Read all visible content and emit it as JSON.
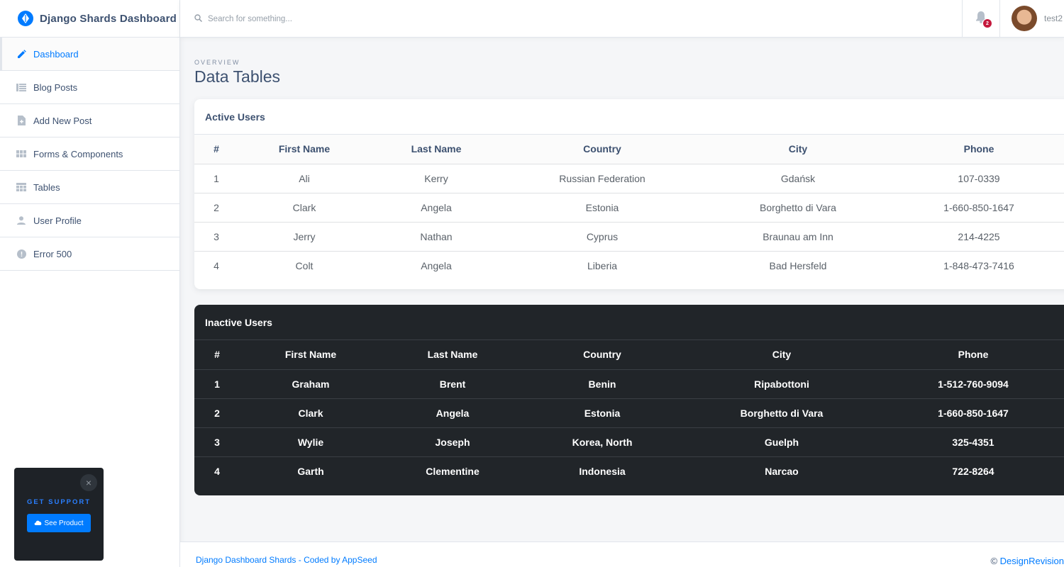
{
  "brand": {
    "title": "Django Shards Dashboard"
  },
  "sidebar": {
    "items": [
      {
        "label": "Dashboard",
        "icon": "edit-icon",
        "active": true
      },
      {
        "label": "Blog Posts",
        "icon": "blog-icon"
      },
      {
        "label": "Add New Post",
        "icon": "note-add-icon"
      },
      {
        "label": "Forms & Components",
        "icon": "view-module-icon"
      },
      {
        "label": "Tables",
        "icon": "table-icon"
      },
      {
        "label": "User Profile",
        "icon": "person-icon"
      },
      {
        "label": "Error 500",
        "icon": "error-icon"
      }
    ]
  },
  "support": {
    "title": "GET SUPPORT",
    "button": "See Product",
    "close": "×"
  },
  "header": {
    "search_placeholder": "Search for something...",
    "notification_count": "2",
    "username": "test2"
  },
  "page": {
    "subtitle": "OVERVIEW",
    "title": "Data Tables"
  },
  "active_users": {
    "title": "Active Users",
    "columns": [
      "#",
      "First Name",
      "Last Name",
      "Country",
      "City",
      "Phone"
    ],
    "rows": [
      [
        "1",
        "Ali",
        "Kerry",
        "Russian Federation",
        "Gdańsk",
        "107-0339"
      ],
      [
        "2",
        "Clark",
        "Angela",
        "Estonia",
        "Borghetto di Vara",
        "1-660-850-1647"
      ],
      [
        "3",
        "Jerry",
        "Nathan",
        "Cyprus",
        "Braunau am Inn",
        "214-4225"
      ],
      [
        "4",
        "Colt",
        "Angela",
        "Liberia",
        "Bad Hersfeld",
        "1-848-473-7416"
      ]
    ]
  },
  "inactive_users": {
    "title": "Inactive Users",
    "columns": [
      "#",
      "First Name",
      "Last Name",
      "Country",
      "City",
      "Phone"
    ],
    "rows": [
      [
        "1",
        "Graham",
        "Brent",
        "Benin",
        "Ripabottoni",
        "1-512-760-9094"
      ],
      [
        "2",
        "Clark",
        "Angela",
        "Estonia",
        "Borghetto di Vara",
        "1-660-850-1647"
      ],
      [
        "3",
        "Wylie",
        "Joseph",
        "Korea, North",
        "Guelph",
        "325-4351"
      ],
      [
        "4",
        "Garth",
        "Clementine",
        "Indonesia",
        "Narcao",
        "722-8264"
      ]
    ]
  },
  "footer": {
    "link": "Django Dashboard Shards - Coded by AppSeed",
    "copyright_symbol": "©",
    "copyright_brand": "DesignRevision"
  },
  "colors": {
    "accent": "#007bff",
    "dark_card": "#212529",
    "badge": "#c4183c",
    "text": "#3d5170"
  }
}
